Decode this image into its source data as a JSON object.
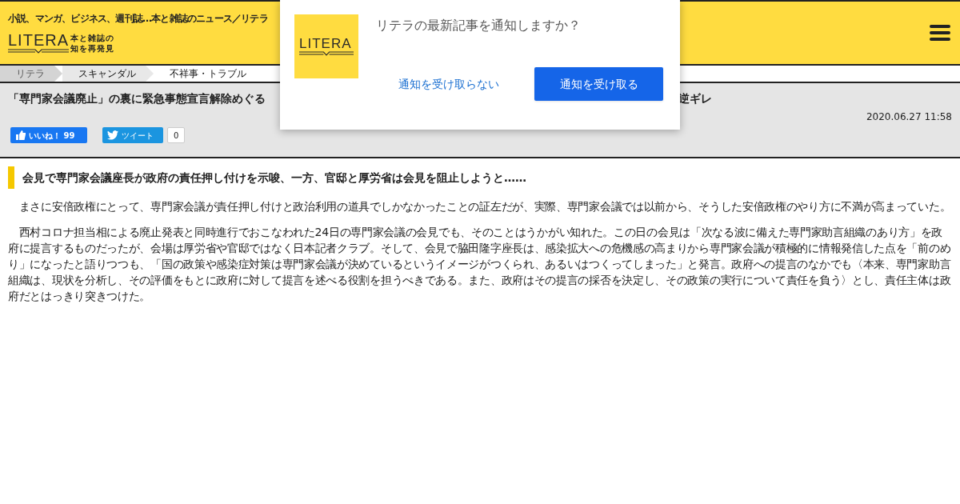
{
  "header": {
    "tagline": "小説、マンガ、ビジネス、週刊誌…本と雑誌のニュース／リテラ",
    "logo": {
      "wordmark": "LITERA",
      "slogan_lines": [
        "本と雑誌の",
        "知を再発見"
      ]
    }
  },
  "breadcrumbs": [
    {
      "label": "リテラ",
      "selected": false
    },
    {
      "label": "スキャンダル",
      "selected": false
    },
    {
      "label": "不祥事・トラブル",
      "selected": true
    }
  ],
  "article": {
    "title_visible_start": "「専門家会議廃止」の裏に緊急事態宣言解除めぐる",
    "title_visible_end": "逆ギレ",
    "date": "2020.06.27 11:58",
    "like_button": "いいね！ 99",
    "tweet_button": "ツイート",
    "tweet_count": "0",
    "subheading": "会見で専門家会議座長が政府の責任押し付けを示唆、一方、官邸と厚労省は会見を阻止しようと……",
    "paragraphs": [
      "　まさに安倍政権にとって、専門家会議が責任押し付けと政治利用の道具でしかなかったことの証左だが、実際、専門家会議では以前から、そうした安倍政権のやり方に不満が高まっていた。",
      "　西村コロナ担当相による廃止発表と同時進行でおこなわれた24日の専門家会議の会見でも、そのことはうかがい知れた。この日の会見は「次なる波に備えた専門家助言組織のあり方」を政府に提言するものだったが、会場は厚労省や官邸ではなく日本記者クラブ。そして、会見で脇田隆字座長は、感染拡大への危機感の高まりから専門家会議が積極的に情報発信した点を「前のめり」になったと語りつつも、「国の政策や感染症対策は専門家会議が決めているというイメージがつくられ、あるいはつくってしまった」と発言。政府への提言のなかでも〈本来、専門家助言組織は、現状を分析し、その評価をもとに政府に対して提言を述べる役割を担うべきである。また、政府はその提言の採否を決定し、その政策の実行について責任を負う〉とし、責任主体は政府だとはっきり突きつけた。"
    ]
  },
  "notification_dialog": {
    "logo_wordmark": "LITERA",
    "message": "リテラの最新記事を通知しますか？",
    "decline_button": "通知を受け取らない",
    "accept_button": "通知を受け取る"
  }
}
